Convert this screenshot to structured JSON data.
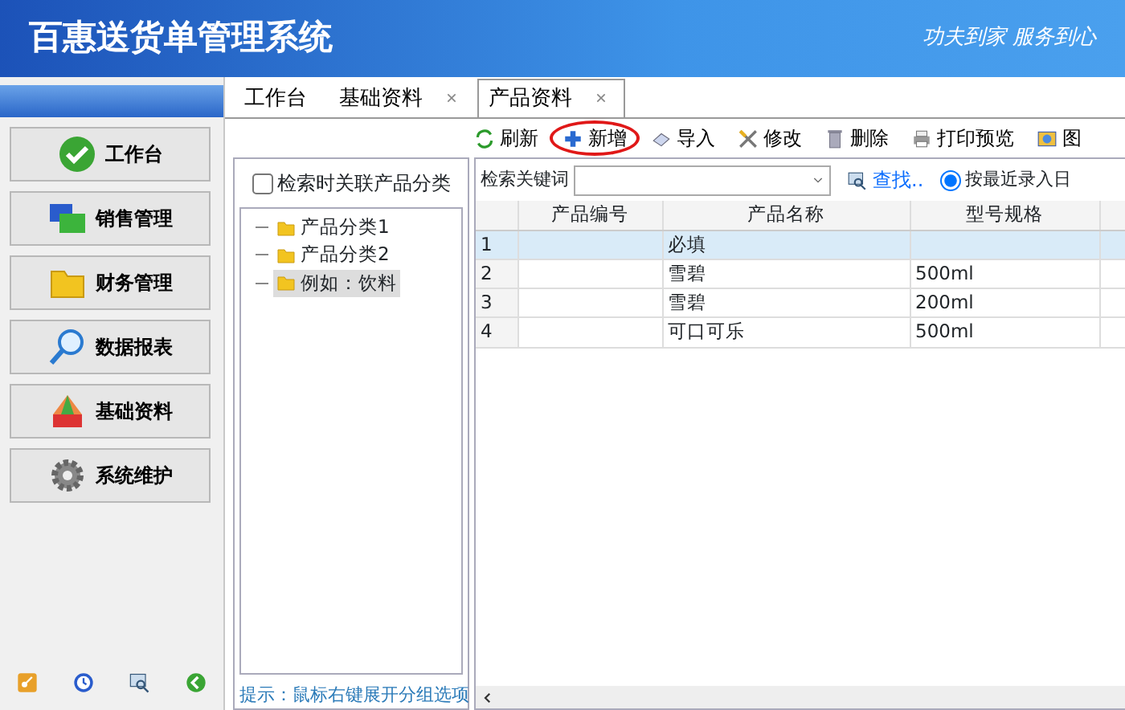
{
  "header": {
    "title": "百惠送货单管理系统",
    "slogan": "功夫到家 服务到心"
  },
  "sidebar": {
    "items": [
      {
        "label": "工作台",
        "kind": "check"
      },
      {
        "label": "销售管理",
        "kind": "windows"
      },
      {
        "label": "财务管理",
        "kind": "folder"
      },
      {
        "label": "数据报表",
        "kind": "magnifier"
      },
      {
        "label": "基础资料",
        "kind": "palette"
      },
      {
        "label": "系统维护",
        "kind": "gear"
      }
    ]
  },
  "tabs": [
    {
      "label": "工作台",
      "closable": false,
      "selected": false
    },
    {
      "label": "基础资料",
      "closable": true,
      "selected": false
    },
    {
      "label": "产品资料",
      "closable": true,
      "selected": true
    }
  ],
  "toolbar": [
    {
      "label": "刷新",
      "kind": "refresh",
      "highlighted": false
    },
    {
      "label": "新增",
      "kind": "add",
      "highlighted": true
    },
    {
      "label": "导入",
      "kind": "import",
      "highlighted": false
    },
    {
      "label": "修改",
      "kind": "edit",
      "highlighted": false
    },
    {
      "label": "删除",
      "kind": "delete",
      "highlighted": false
    },
    {
      "label": "打印预览",
      "kind": "print",
      "highlighted": false
    },
    {
      "label": "图",
      "kind": "image",
      "highlighted": false
    }
  ],
  "category_panel": {
    "link_checkbox": {
      "label": "检索时关联产品分类",
      "checked": false
    },
    "tree": [
      {
        "label": "产品分类1",
        "selected": false
      },
      {
        "label": "产品分类2",
        "selected": false
      },
      {
        "label": "例如：饮料",
        "selected": true
      }
    ],
    "hint": "提示：鼠标右键展开分组选项"
  },
  "search": {
    "label": "检索关键词",
    "find": "查找..",
    "sort_option": {
      "label": "按最近录入日",
      "selected": true
    }
  },
  "table": {
    "columns": [
      "产品编号",
      "产品名称",
      "型号规格"
    ],
    "rows": [
      {
        "number": "1",
        "cells": [
          "",
          "必填",
          ""
        ],
        "selected": true
      },
      {
        "number": "2",
        "cells": [
          "",
          "雪碧",
          "500ml"
        ],
        "selected": false
      },
      {
        "number": "3",
        "cells": [
          "",
          "雪碧",
          "200ml"
        ],
        "selected": false
      },
      {
        "number": "4",
        "cells": [
          "",
          "可口可乐",
          "500ml"
        ],
        "selected": false
      }
    ]
  }
}
